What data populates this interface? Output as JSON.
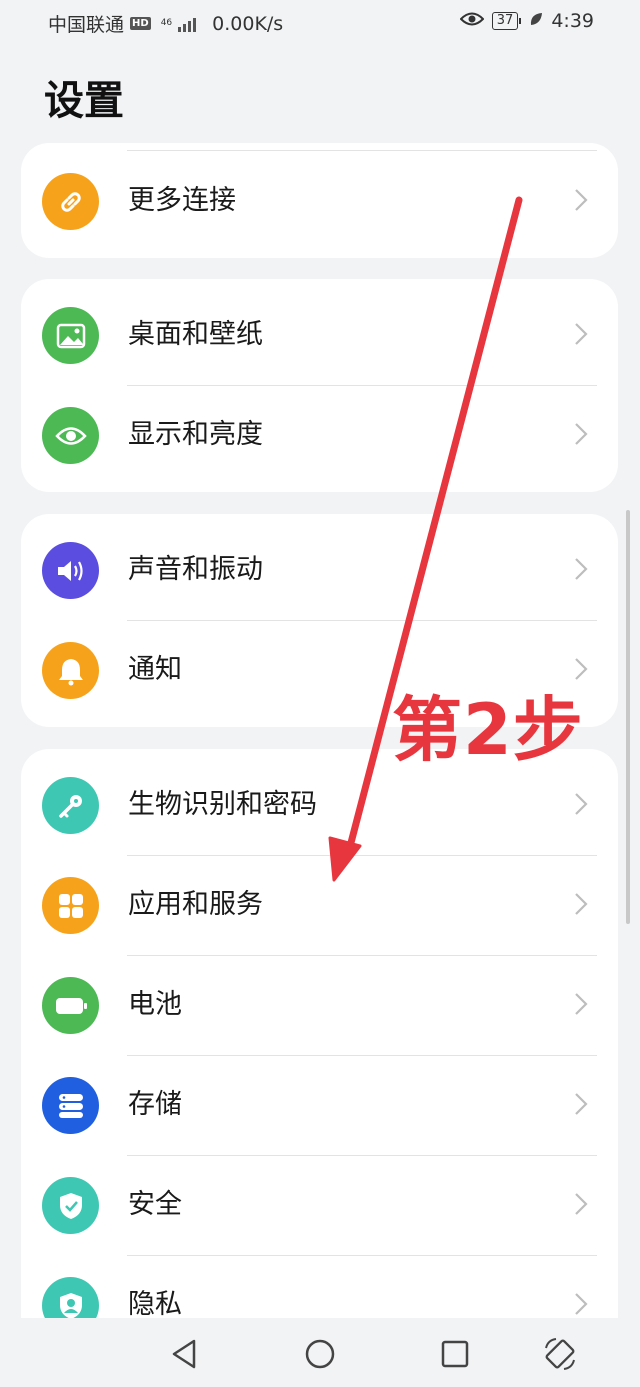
{
  "status_bar": {
    "carrier": "中国联通",
    "hd": "HD",
    "net_type": "46",
    "speed": "0.00K/s",
    "battery": "37",
    "time": "4:39"
  },
  "title": "设置",
  "groups": [
    {
      "items": [
        {
          "label": "更多连接",
          "icon": "link-icon",
          "color": "#f7a21b"
        }
      ]
    },
    {
      "items": [
        {
          "label": "桌面和壁纸",
          "icon": "image-icon",
          "color": "#4cb954"
        },
        {
          "label": "显示和亮度",
          "icon": "eye-icon",
          "color": "#4cb954"
        }
      ]
    },
    {
      "items": [
        {
          "label": "声音和振动",
          "icon": "speaker-icon",
          "color": "#5a4de0"
        },
        {
          "label": "通知",
          "icon": "bell-icon",
          "color": "#f7a21b"
        }
      ]
    },
    {
      "items": [
        {
          "label": "生物识别和密码",
          "icon": "key-icon",
          "color": "#3ec7b3"
        },
        {
          "label": "应用和服务",
          "icon": "apps-icon",
          "color": "#f7a21b"
        },
        {
          "label": "电池",
          "icon": "battery-icon",
          "color": "#4cb954"
        },
        {
          "label": "存储",
          "icon": "storage-icon",
          "color": "#1f5fe0"
        },
        {
          "label": "安全",
          "icon": "shield-icon",
          "color": "#3ec7b3"
        },
        {
          "label": "隐私",
          "icon": "privacy-icon",
          "color": "#3ec7b3"
        }
      ]
    }
  ],
  "annotation": {
    "text": "第2步",
    "color": "#e8363f"
  },
  "nav": {
    "back": "back-icon",
    "home": "home-icon",
    "recents": "recents-icon",
    "rotate": "rotate-icon"
  }
}
